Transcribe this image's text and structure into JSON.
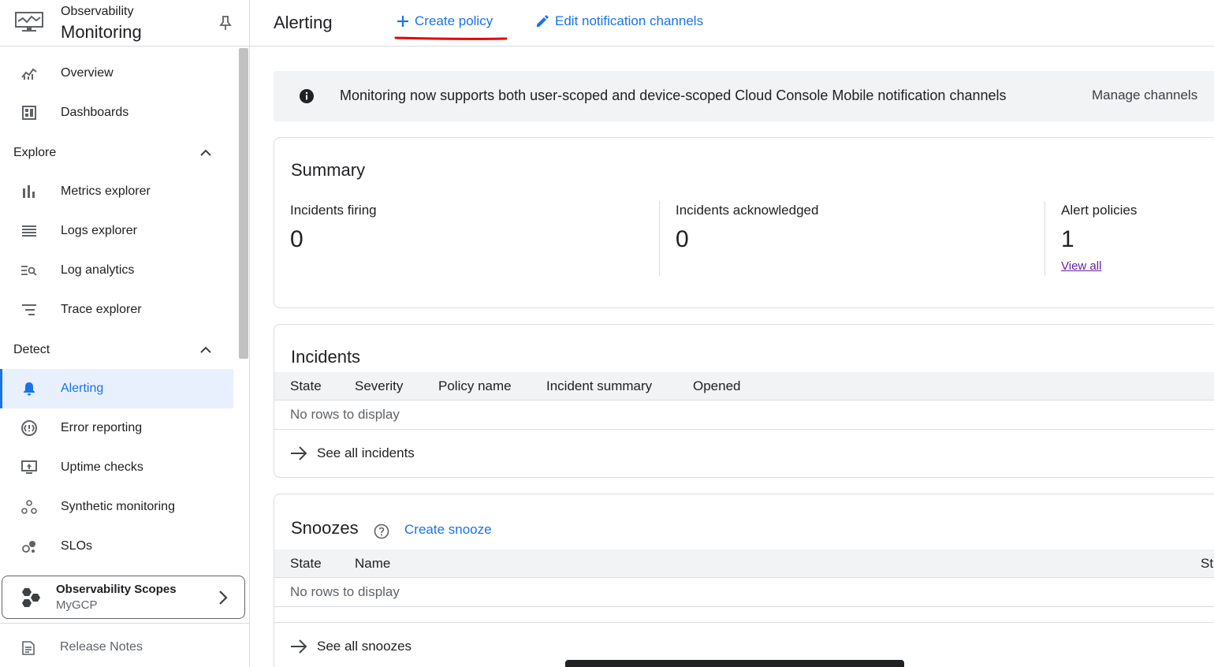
{
  "app": {
    "superscript": "Observability",
    "title": "Monitoring"
  },
  "sidebar": {
    "items_top": [
      {
        "label": "Overview",
        "icon": "chart-line-icon"
      },
      {
        "label": "Dashboards",
        "icon": "dashboard-icon"
      }
    ],
    "explore": {
      "label": "Explore",
      "items": [
        {
          "label": "Metrics explorer",
          "icon": "bar-chart-icon"
        },
        {
          "label": "Logs explorer",
          "icon": "list-icon"
        },
        {
          "label": "Log analytics",
          "icon": "search-list-icon"
        },
        {
          "label": "Trace explorer",
          "icon": "trace-icon"
        }
      ]
    },
    "detect": {
      "label": "Detect",
      "items": [
        {
          "label": "Alerting",
          "icon": "bell-icon",
          "active": true
        },
        {
          "label": "Error reporting",
          "icon": "error-icon"
        },
        {
          "label": "Uptime checks",
          "icon": "monitor-icon"
        },
        {
          "label": "Synthetic monitoring",
          "icon": "nodes-icon"
        },
        {
          "label": "SLOs",
          "icon": "slo-icon"
        }
      ]
    },
    "scope": {
      "title": "Observability Scopes",
      "project": "MyGCP"
    },
    "release_notes": "Release Notes"
  },
  "header": {
    "title": "Alerting",
    "create_policy": "Create policy",
    "edit_channels": "Edit notification channels"
  },
  "banner": {
    "message": "Monitoring now supports both user-scoped and device-scoped Cloud Console Mobile notification channels",
    "action": "Manage channels"
  },
  "summary": {
    "title": "Summary",
    "stats": [
      {
        "label": "Incidents firing",
        "value": "0"
      },
      {
        "label": "Incidents acknowledged",
        "value": "0"
      },
      {
        "label": "Alert policies",
        "value": "1",
        "link": "View all"
      }
    ]
  },
  "incidents": {
    "title": "Incidents",
    "columns": [
      "State",
      "Severity",
      "Policy name",
      "Incident summary",
      "Opened"
    ],
    "empty": "No rows to display",
    "see_all": "See all incidents"
  },
  "snoozes": {
    "title": "Snoozes",
    "create": "Create snooze",
    "columns": [
      "State",
      "Name",
      "St"
    ],
    "empty": "No rows to display",
    "see_all": "See all snoozes"
  },
  "colors": {
    "accent": "#1a73e8",
    "annotation": "#e8000b",
    "visited_link": "#681da8"
  }
}
